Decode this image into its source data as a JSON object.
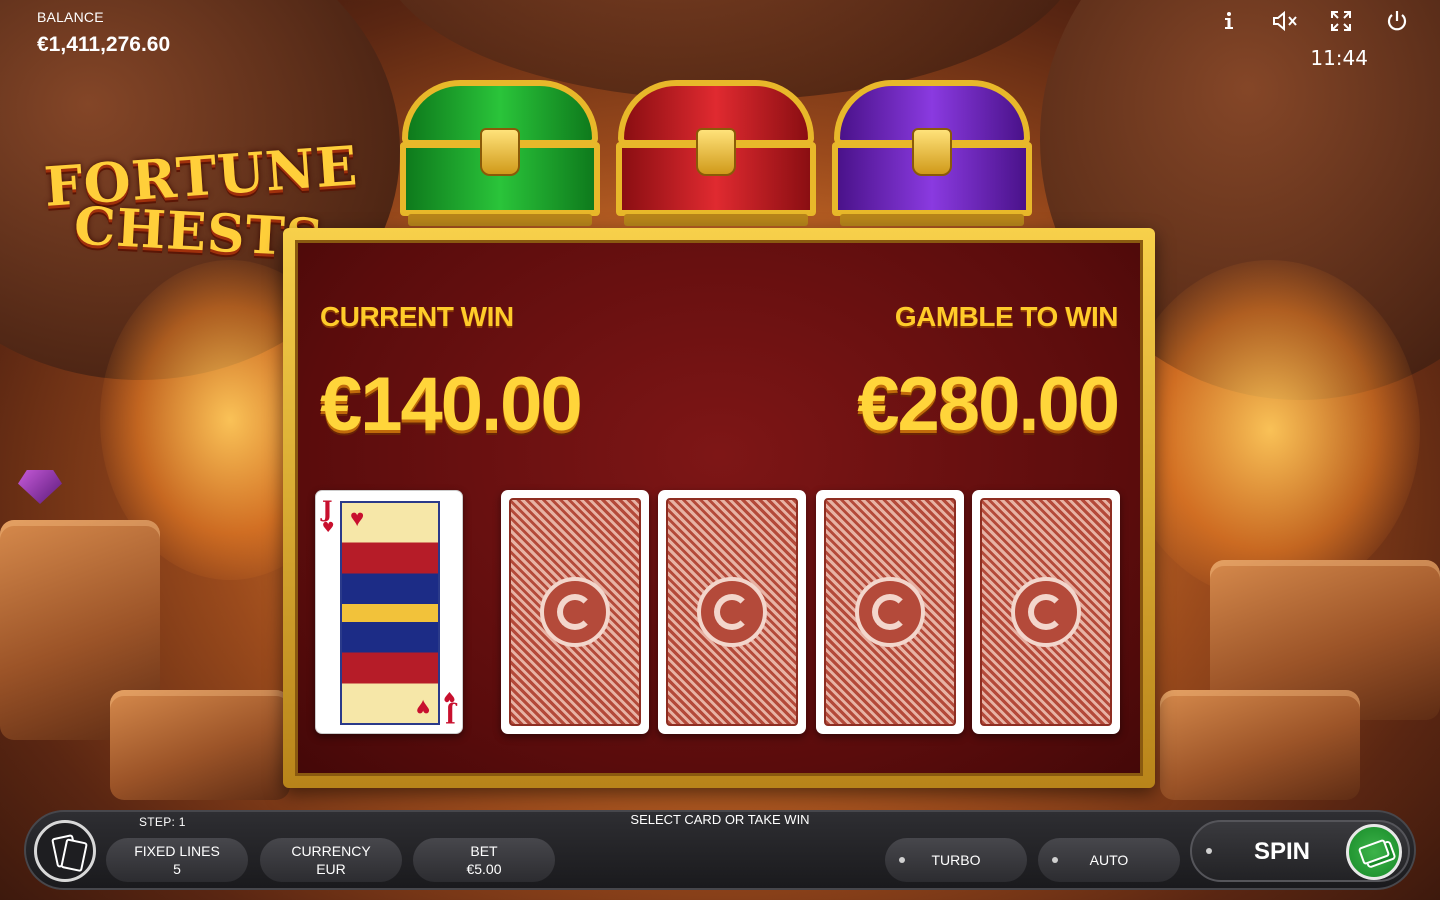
{
  "header": {
    "balance_label": "BALANCE",
    "balance_value": "€1,411,276.60",
    "clock": "11:44",
    "icons": [
      "info-icon",
      "sound-muted-icon",
      "fullscreen-icon",
      "power-icon"
    ]
  },
  "logo": {
    "line1": "FORTUNE",
    "line2": "CHESTS"
  },
  "chests": [
    {
      "color": "#1aa82a",
      "name": "green-chest"
    },
    {
      "color": "#c81e24",
      "name": "red-chest"
    },
    {
      "color": "#7a2ad0",
      "name": "purple-chest"
    }
  ],
  "gamble": {
    "current_win_label": "CURRENT WIN",
    "current_win_value": "€140.00",
    "gamble_to_win_label": "GAMBLE TO WIN",
    "gamble_to_win_value": "€280.00",
    "dealer_card": {
      "rank": "J",
      "suit": "♥"
    },
    "face_down_cards": 4
  },
  "bottom_bar": {
    "step": "STEP: 1",
    "prompt": "SELECT CARD OR TAKE WIN",
    "fixed_lines_label": "FIXED LINES",
    "fixed_lines_value": "5",
    "currency_label": "CURRENCY",
    "currency_value": "EUR",
    "bet_label": "BET",
    "bet_value": "€5.00",
    "turbo_label": "TURBO",
    "auto_label": "AUTO",
    "spin_label": "SPIN"
  },
  "colors": {
    "gold_text": "#ffcc2a",
    "panel_red": "#5a0c0c",
    "spin_green": "#2ea23c"
  }
}
